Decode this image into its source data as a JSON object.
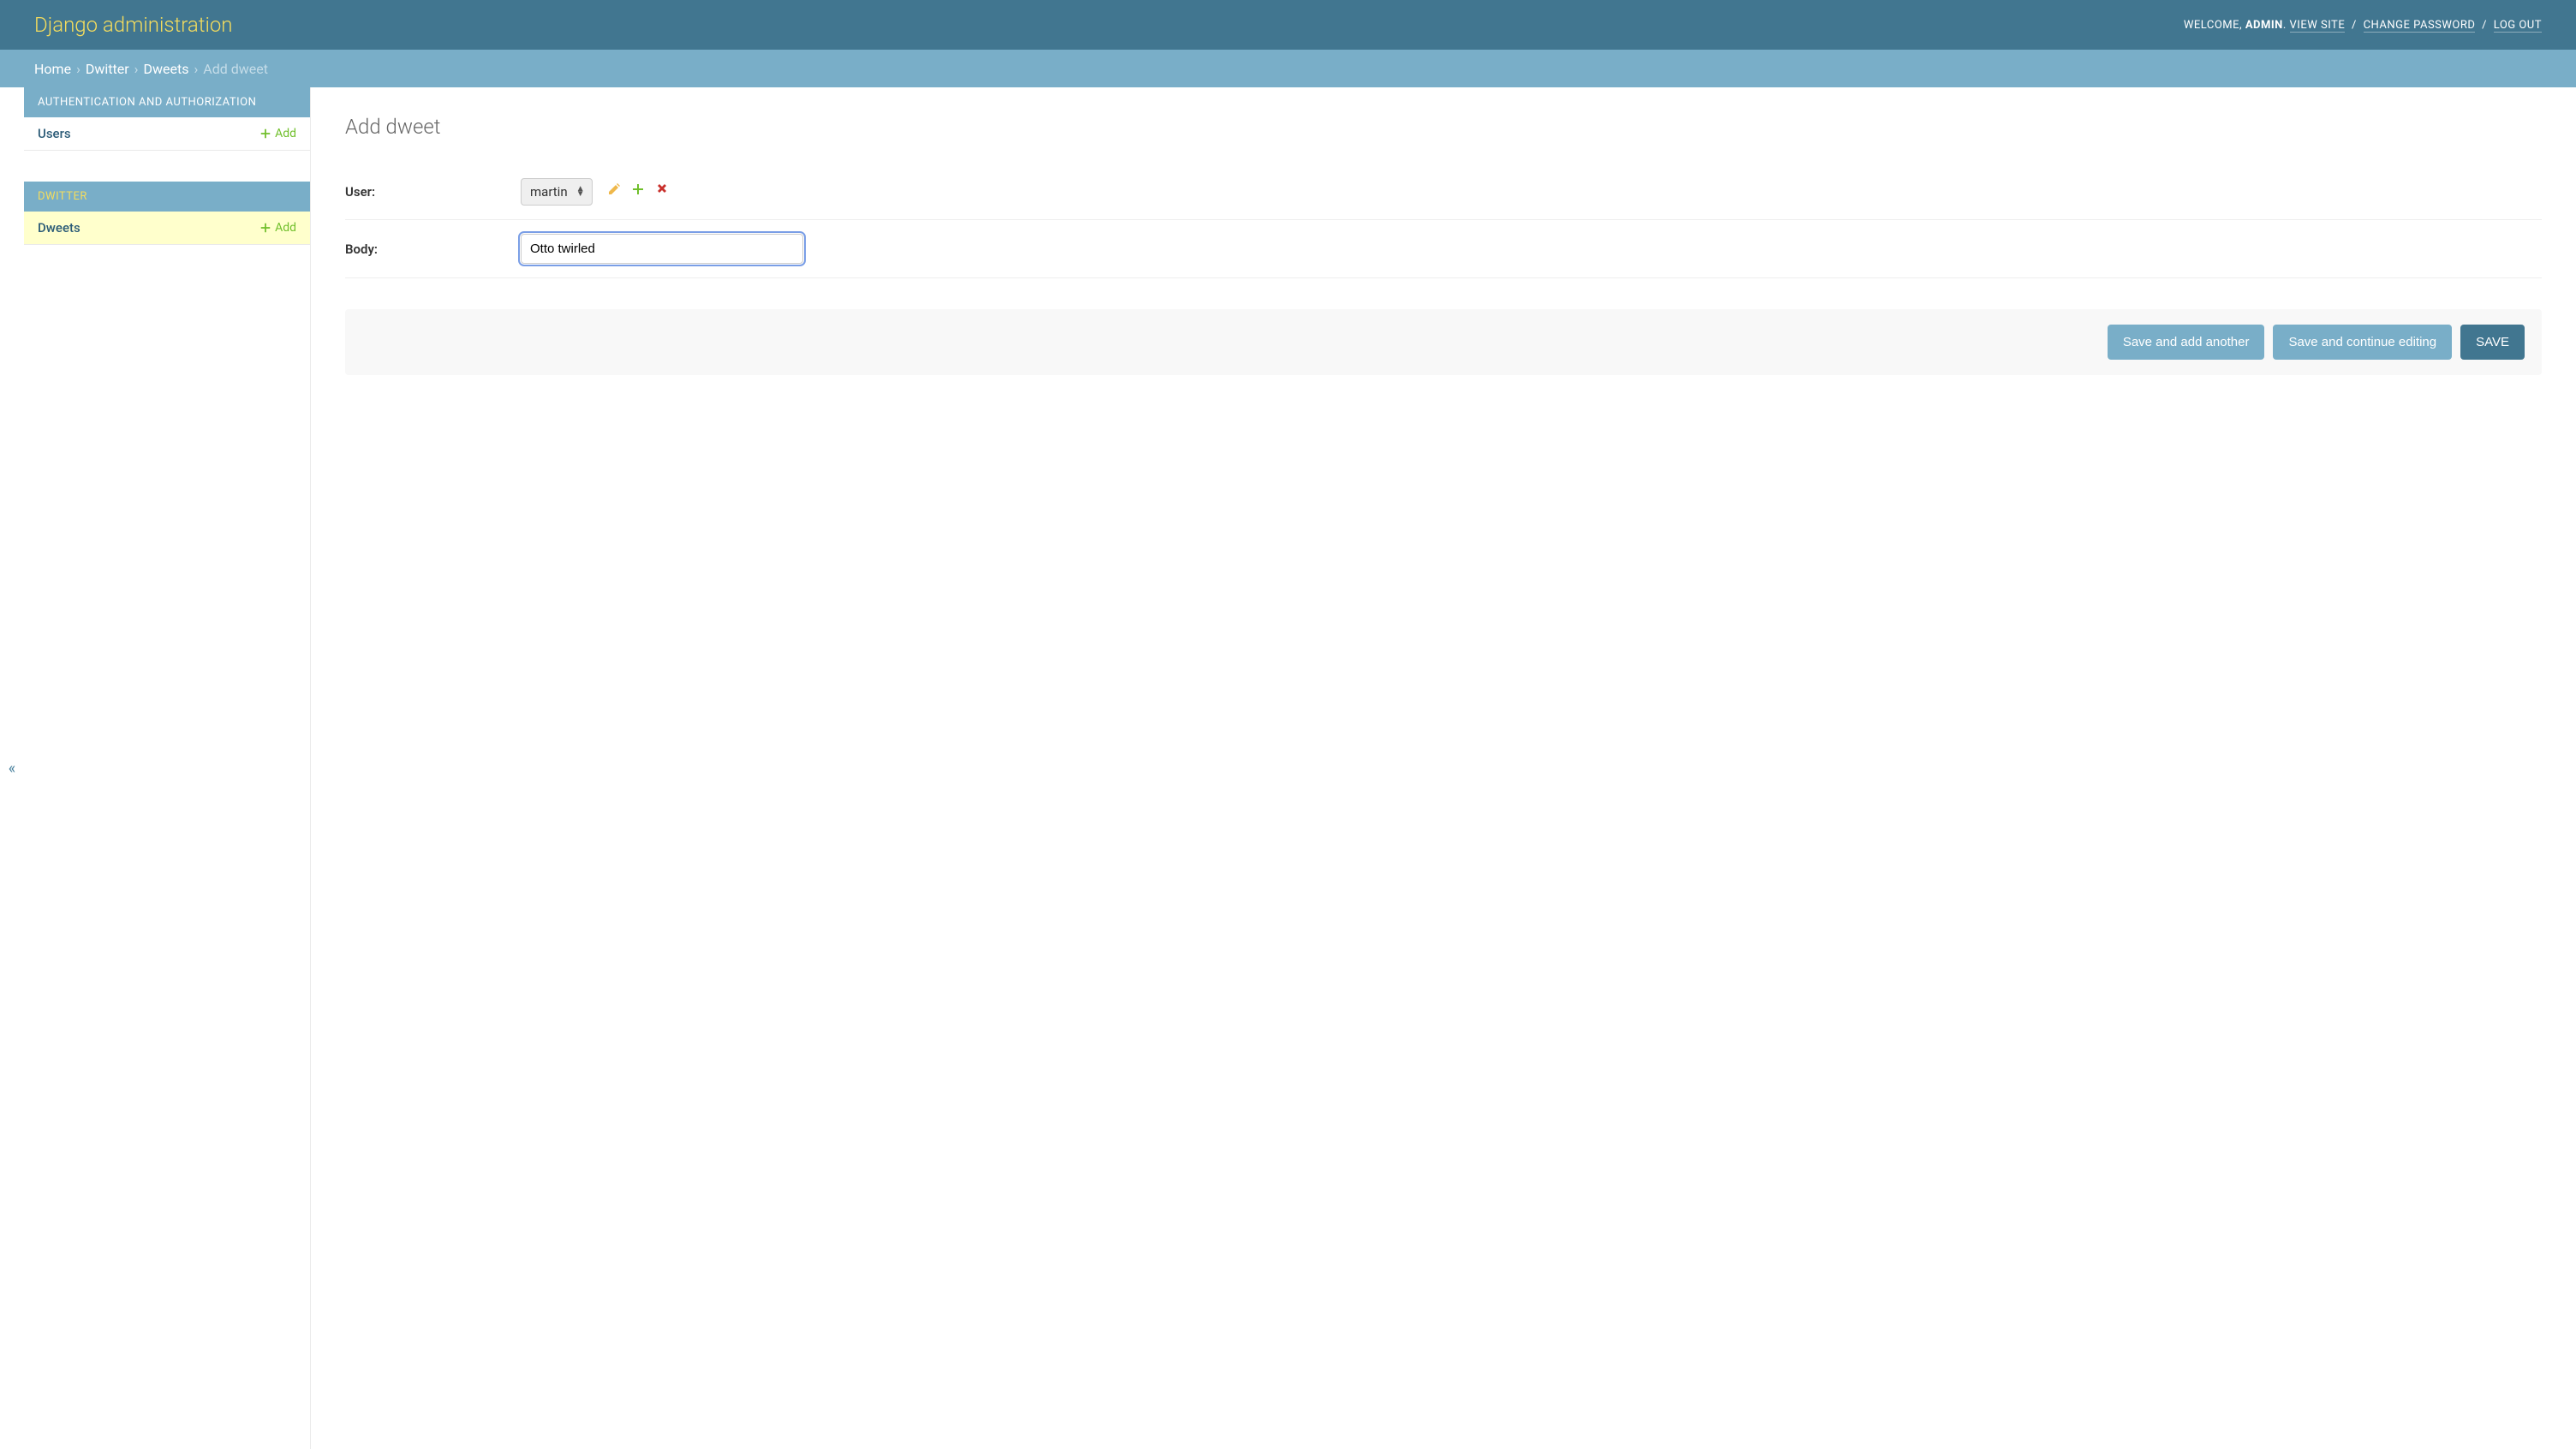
{
  "header": {
    "branding": "Django administration",
    "welcome": "WELCOME,",
    "username": "ADMIN",
    "view_site": "VIEW SITE",
    "change_password": "CHANGE PASSWORD",
    "logout": "LOG OUT"
  },
  "breadcrumbs": {
    "home": "Home",
    "app": "Dwitter",
    "model": "Dweets",
    "current": "Add dweet"
  },
  "sidebar": {
    "auth_caption": "AUTHENTICATION AND AUTHORIZATION",
    "users": "Users",
    "dwitter_caption": "DWITTER",
    "dweets": "Dweets",
    "add_label": "Add"
  },
  "page": {
    "title": "Add dweet"
  },
  "form": {
    "user_label": "User:",
    "user_value": "martin",
    "body_label": "Body:",
    "body_value": "Otto twirled"
  },
  "actions": {
    "save_add_another": "Save and add another",
    "save_continue": "Save and continue editing",
    "save": "SAVE"
  }
}
